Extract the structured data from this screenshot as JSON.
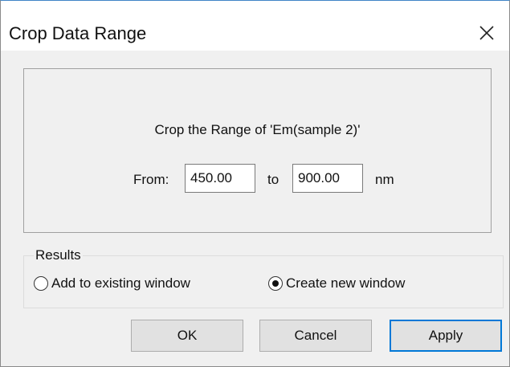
{
  "window": {
    "title": "Crop Data Range"
  },
  "range": {
    "prompt": "Crop the Range of 'Em(sample 2)'",
    "from_label": "From:",
    "from_value": "450.00",
    "to_label": "to",
    "to_value": "900.00",
    "unit": "nm"
  },
  "results": {
    "legend": "Results",
    "options": [
      {
        "label": "Add to existing window",
        "selected": false
      },
      {
        "label": "Create new window",
        "selected": true
      }
    ]
  },
  "buttons": {
    "ok": "OK",
    "cancel": "Cancel",
    "apply": "Apply"
  },
  "colors": {
    "accent": "#0078d7",
    "dialog_bg": "#f0f0f0"
  },
  "icons": {
    "close": "close-icon"
  }
}
